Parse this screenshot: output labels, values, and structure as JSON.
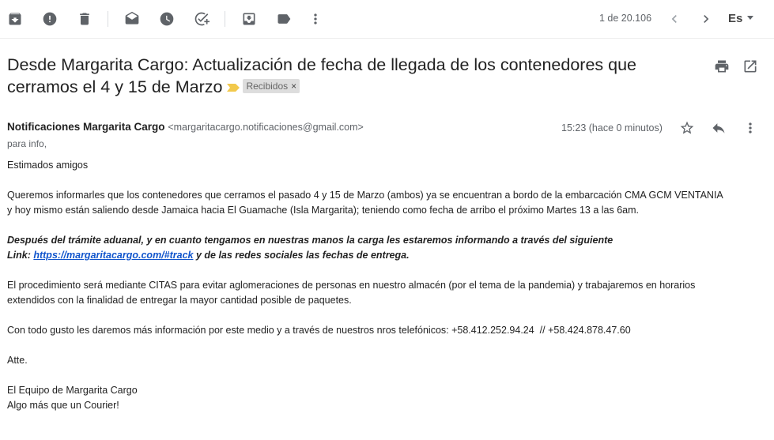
{
  "toolbar": {
    "icons": [
      "archive-icon",
      "report-spam-icon",
      "delete-icon",
      "mark-unread-icon",
      "snooze-icon",
      "add-task-icon",
      "move-to-icon",
      "label-icon",
      "more-vert-icon"
    ],
    "pager": "1 de 20.106",
    "language": "Es"
  },
  "email": {
    "subject": "Desde Margarita Cargo: Actualización de fecha de llegada de los contenedores que cerramos el 4 y 15 de Marzo",
    "label": "Recibidos",
    "label_remove": "×",
    "sender_name": "Notificaciones Margarita Cargo",
    "sender_email": "<margaritacargo.notificaciones@gmail.com>",
    "to": "para info,",
    "time": "15:23 (hace 0 minutos)",
    "body": {
      "greeting": "Estimados amigos",
      "p1_line1": "Queremos informarles que los contenedores que cerramos el pasado 4 y 15 de Marzo (ambos) ya se encuentran a bordo de la embarcación CMA GCM VENTANIA",
      "p1_line2": "y hoy mismo están saliendo desde Jamaica hacia El Guamache (Isla Margarita); teniendo como fecha de arribo el próximo Martes 13 a las 6am.",
      "p2_line1": "Después del trámite aduanal, y en cuanto tengamos en nuestras manos la carga les estaremos informando a través del siguiente",
      "p2_link_prefix": "Link: ",
      "p2_link": "https://margaritacargo.com/#track",
      "p2_suffix": " y de las redes sociales las fechas de entrega.",
      "p3_line1": "El procedimiento será mediante CITAS para evitar aglomeraciones de personas en nuestro almacén (por el tema de la pandemia) y trabajaremos en horarios",
      "p3_line2": "extendidos con la finalidad de entregar la mayor cantidad posible de paquetes.",
      "p4": "Con todo gusto les daremos más información por este medio y a través de nuestros nros telefónicos: +58.412.252.94.24  // +58.424.878.47.60",
      "signoff": "Atte.",
      "sig1": "El Equipo de Margarita Cargo",
      "sig2": "Algo más que un Courier!"
    }
  },
  "colors": {
    "link": "#1155cc",
    "important_marker": "#f2c94c",
    "icon": "#5f6368"
  }
}
